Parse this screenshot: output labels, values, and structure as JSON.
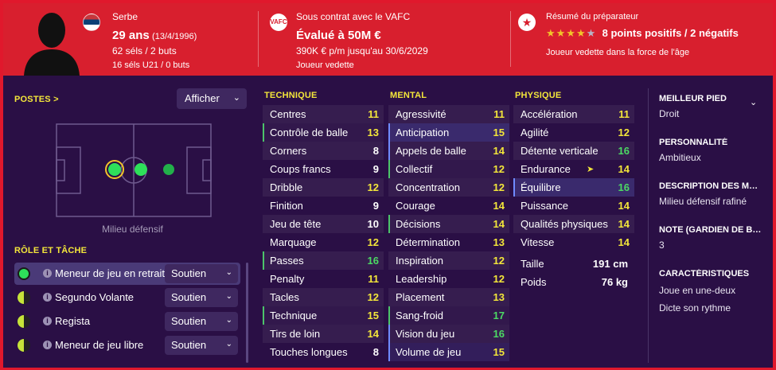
{
  "header": {
    "nationality": "Serbe",
    "age": "29 ans",
    "birthdate": "(13/4/1996)",
    "caps": "62 séls / 2 buts",
    "u21": "16 séls U21 / 0 buts",
    "contract": "Sous contrat avec le VAFC",
    "value": "Évalué à 50M €",
    "wage": "390K € p/m jusqu'au 30/6/2029",
    "squad_status": "Joueur vedette",
    "club_badge": "VAFC",
    "report_title": "Résumé du préparateur",
    "report_summary": "8 points positifs / 2 négatifs",
    "report_detail": "Joueur vedette dans la force de l'âge",
    "star_rating": 4,
    "star_max": 5
  },
  "left": {
    "positions_title": "POSTES >",
    "afficher_label": "Afficher",
    "pitch_label": "Milieu défensif",
    "roles_title": "RÔLE ET TÂCHE",
    "roles": [
      {
        "name": "Meneur de jeu en retrait",
        "duty": "Soutien"
      },
      {
        "name": "Segundo Volante",
        "duty": "Soutien"
      },
      {
        "name": "Regista",
        "duty": "Soutien"
      },
      {
        "name": "Meneur de jeu libre",
        "duty": "Soutien"
      }
    ]
  },
  "technique": {
    "title": "TECHNIQUE",
    "rows": [
      {
        "name": "Centres",
        "value": "11"
      },
      {
        "name": "Contrôle de balle",
        "value": "13"
      },
      {
        "name": "Corners",
        "value": "8"
      },
      {
        "name": "Coups francs",
        "value": "9"
      },
      {
        "name": "Dribble",
        "value": "12"
      },
      {
        "name": "Finition",
        "value": "9"
      },
      {
        "name": "Jeu de tête",
        "value": "10"
      },
      {
        "name": "Marquage",
        "value": "12"
      },
      {
        "name": "Passes",
        "value": "16"
      },
      {
        "name": "Penalty",
        "value": "11"
      },
      {
        "name": "Tacles",
        "value": "12"
      },
      {
        "name": "Technique",
        "value": "15"
      },
      {
        "name": "Tirs de loin",
        "value": "14"
      },
      {
        "name": "Touches longues",
        "value": "8"
      }
    ]
  },
  "mental": {
    "title": "MENTAL",
    "rows": [
      {
        "name": "Agressivité",
        "value": "11"
      },
      {
        "name": "Anticipation",
        "value": "15"
      },
      {
        "name": "Appels de balle",
        "value": "14"
      },
      {
        "name": "Collectif",
        "value": "12"
      },
      {
        "name": "Concentration",
        "value": "12"
      },
      {
        "name": "Courage",
        "value": "14"
      },
      {
        "name": "Décisions",
        "value": "14"
      },
      {
        "name": "Détermination",
        "value": "13"
      },
      {
        "name": "Inspiration",
        "value": "12"
      },
      {
        "name": "Leadership",
        "value": "12"
      },
      {
        "name": "Placement",
        "value": "13"
      },
      {
        "name": "Sang-froid",
        "value": "17"
      },
      {
        "name": "Vision du jeu",
        "value": "16"
      },
      {
        "name": "Volume de jeu",
        "value": "15"
      }
    ]
  },
  "physique": {
    "title": "PHYSIQUE",
    "rows": [
      {
        "name": "Accélération",
        "value": "11"
      },
      {
        "name": "Agilité",
        "value": "12"
      },
      {
        "name": "Détente verticale",
        "value": "16"
      },
      {
        "name": "Endurance",
        "value": "14"
      },
      {
        "name": "Équilibre",
        "value": "16"
      },
      {
        "name": "Puissance",
        "value": "14"
      },
      {
        "name": "Qualités physiques",
        "value": "14"
      },
      {
        "name": "Vitesse",
        "value": "14"
      }
    ],
    "height_label": "Taille",
    "height_value": "191 cm",
    "weight_label": "Poids",
    "weight_value": "76 kg"
  },
  "right": {
    "foot_label": "MEILLEUR PIED",
    "foot_value": "Droit",
    "personality_label": "PERSONNALITÉ",
    "personality_value": "Ambitieux",
    "description_label": "DESCRIPTION DES MÉDIAS",
    "description_value": "Milieu défensif rafiné",
    "gk_label": "NOTE (GARDIEN DE BUT)",
    "gk_value": "3",
    "traits_label": "CARACTÉRISTIQUES",
    "traits": [
      "Joue en une-deux",
      "Dicte son rythme"
    ]
  },
  "colors": {
    "accent_red": "#d81f2e",
    "background": "#2a0f45",
    "title_yellow": "#f3e63a",
    "value_green": "#4cd964"
  }
}
